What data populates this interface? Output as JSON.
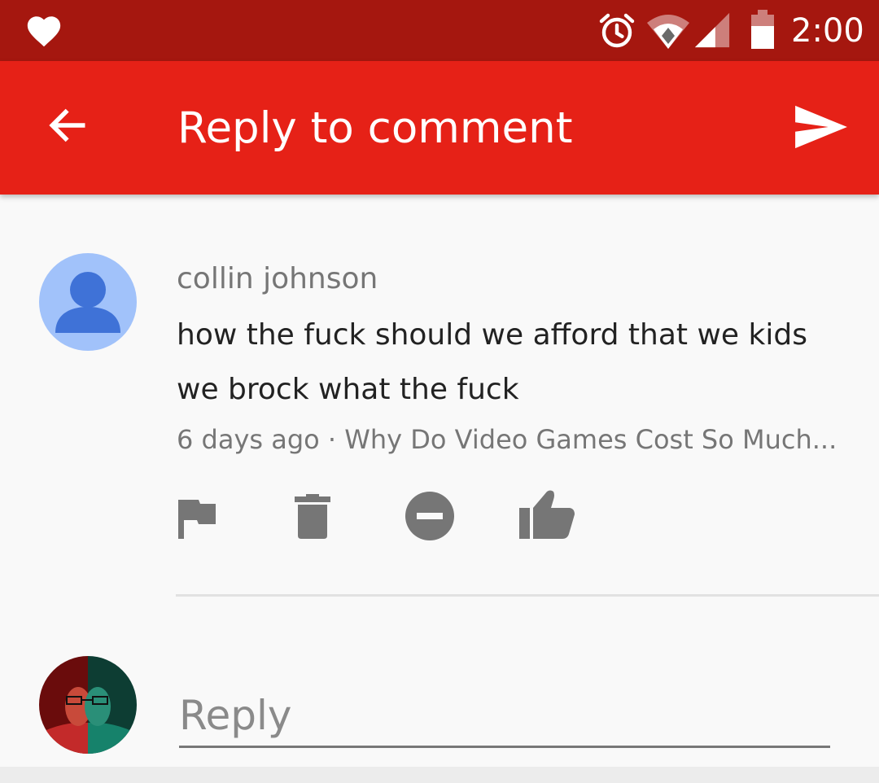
{
  "status_bar": {
    "time": "2:00",
    "icons": [
      "heart-icon",
      "alarm-icon",
      "wifi-icon",
      "signal-icon",
      "battery-icon"
    ],
    "color": "#a5170f"
  },
  "app_bar": {
    "title": "Reply to comment",
    "back_icon": "arrow-back-icon",
    "send_icon": "send-icon",
    "color": "#e62117"
  },
  "comment": {
    "author": "collin johnson",
    "text": "how the fuck should we afford that we kids we brock what the fuck",
    "meta": "6 days ago · Why Do Video Games Cost So Much...",
    "actions": [
      "flag-icon",
      "delete-icon",
      "block-icon",
      "thumb-up-icon"
    ]
  },
  "reply": {
    "placeholder": "Reply"
  }
}
